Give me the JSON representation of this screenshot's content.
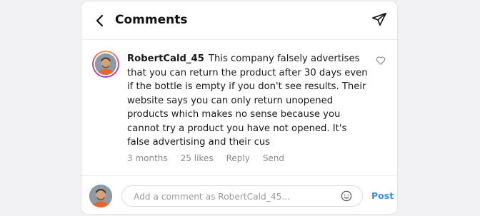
{
  "header": {
    "title": "Comments",
    "back_icon": "chevron-left-icon",
    "share_icon": "paper-plane-icon"
  },
  "comment": {
    "username": "RobertCald_45",
    "text": "This company falsely advertises that you can return the product after 30 days even if the bottle is empty if you don't see results. Their website says you can only return unopened products which makes no sense because you cannot try a product you have not opened. It's false advertising and their cus",
    "time": "3 months",
    "likes": "25 likes",
    "reply_label": "Reply",
    "send_label": "Send",
    "like_icon": "heart-outline-icon"
  },
  "composer": {
    "placeholder": "Add a comment as RobertCald_45...",
    "post_label": "Post",
    "emoji_icon": "smiley-icon"
  },
  "colors": {
    "accent": "#3b8ee8",
    "muted_text": "#8a8a8f",
    "story_ring_start": "#f8a33a",
    "story_ring_mid": "#e4407a"
  }
}
